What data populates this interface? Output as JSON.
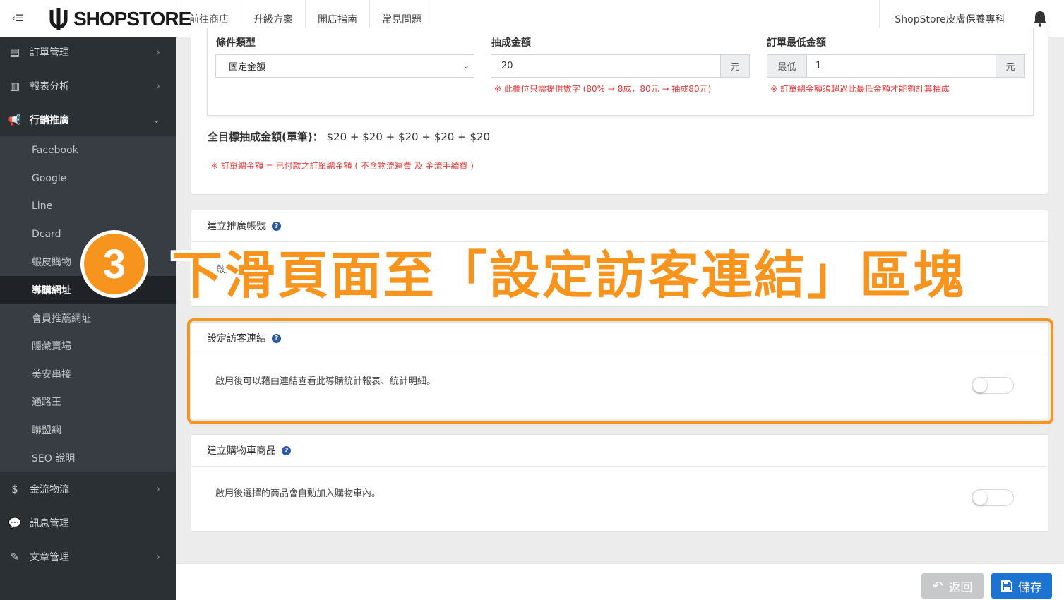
{
  "topbar": {
    "logo_text": "SHOPSTORE",
    "nav": [
      "前往商店",
      "升級方案",
      "開店指南",
      "常見問題"
    ],
    "shop_name": "ShopStore皮膚保養專科"
  },
  "sidebar": {
    "items": [
      {
        "label": "訂單管理",
        "icon": "clipboard-icon"
      },
      {
        "label": "報表分析",
        "icon": "bar-chart-icon"
      },
      {
        "label": "行銷推廣",
        "icon": "megaphone-icon"
      },
      {
        "label": "金流物流",
        "icon": "dollar-icon"
      },
      {
        "label": "訊息管理",
        "icon": "comments-icon"
      },
      {
        "label": "文章管理",
        "icon": "edit-icon"
      }
    ],
    "sub_items": [
      "Facebook",
      "Google",
      "Line",
      "Dcard",
      "蝦皮購物",
      "導購網址",
      "會員推薦網址",
      "隱藏賣場",
      "美安串接",
      "通路王",
      "聯盟網",
      "SEO 說明"
    ],
    "active_sub": "導購網址"
  },
  "commission": {
    "condition_label": "條件類型",
    "condition_value": "固定金額",
    "amount_label": "抽成金額",
    "amount_value": "20",
    "amount_unit": "元",
    "amount_note": "※ 此欄位只需提供數字 (80% → 8成，80元 → 抽成80元)",
    "min_label": "訂單最低金額",
    "min_prefix": "最低",
    "min_value": "1",
    "min_unit": "元",
    "min_note": "※ 訂單總金額須超過此最低金額才能夠計算抽成",
    "total_label": "全目標抽成金額(單筆)：",
    "total_value": "$20 + $20 + $20 + $20 + $20",
    "total_note": "※ 訂單總金額 = 已付款之訂單總金額 ( 不含物流運費 及 金流手續費 )"
  },
  "sections": {
    "promo_account": {
      "title": "建立推廣帳號",
      "desc_visible": "啟用",
      "desc_tail": "計"
    },
    "visitor_link": {
      "title": "設定訪客連結",
      "desc": "啟用後可以藉由連結查看此導購統計報表、統計明細。",
      "enabled": false
    },
    "cart_product": {
      "title": "建立購物車商品",
      "desc": "啟用後選擇的商品會自動加入購物車內。",
      "enabled": false
    }
  },
  "overlay": {
    "step_number": "3",
    "instruction": "下滑頁面至「設定訪客連結」區塊",
    "accent": "#f7941d"
  },
  "footer": {
    "back_label": "返回",
    "save_label": "儲存"
  }
}
